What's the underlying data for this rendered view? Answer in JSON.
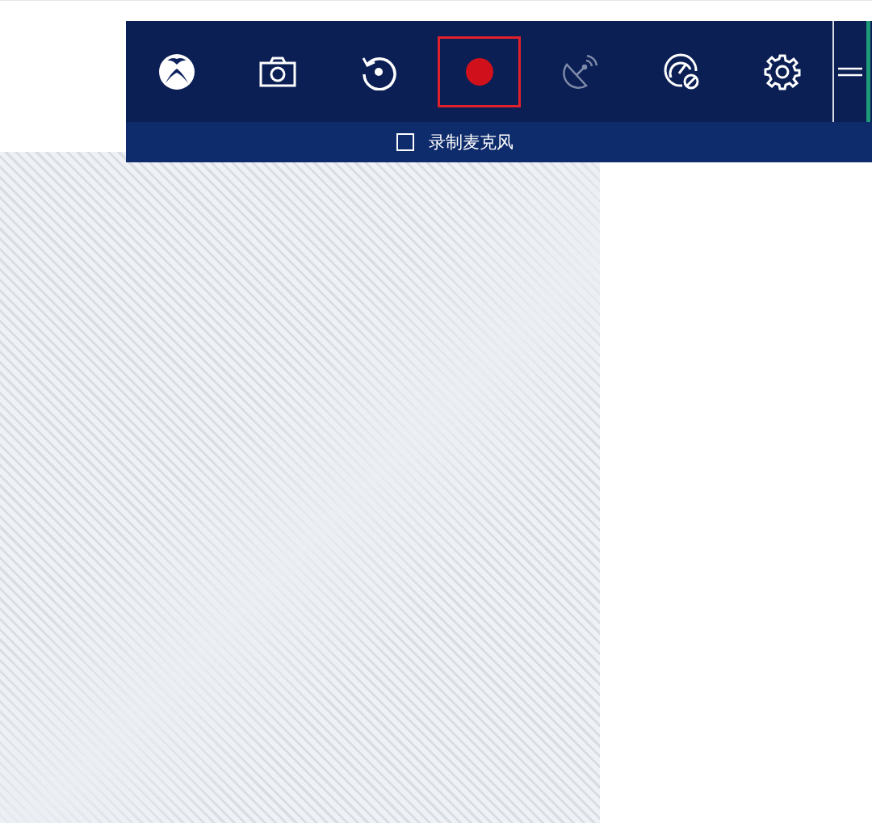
{
  "toolbar": {
    "buttons": [
      {
        "kind": "xbox",
        "selected": false,
        "disabled": false
      },
      {
        "kind": "screenshot",
        "selected": false,
        "disabled": false
      },
      {
        "kind": "replay",
        "selected": false,
        "disabled": false
      },
      {
        "kind": "record",
        "selected": true,
        "disabled": false
      },
      {
        "kind": "broadcast",
        "selected": false,
        "disabled": true
      },
      {
        "kind": "performance",
        "selected": false,
        "disabled": false
      },
      {
        "kind": "settings",
        "selected": false,
        "disabled": false
      }
    ]
  },
  "microphone_option": {
    "label": "录制麦克风",
    "checked": false
  }
}
